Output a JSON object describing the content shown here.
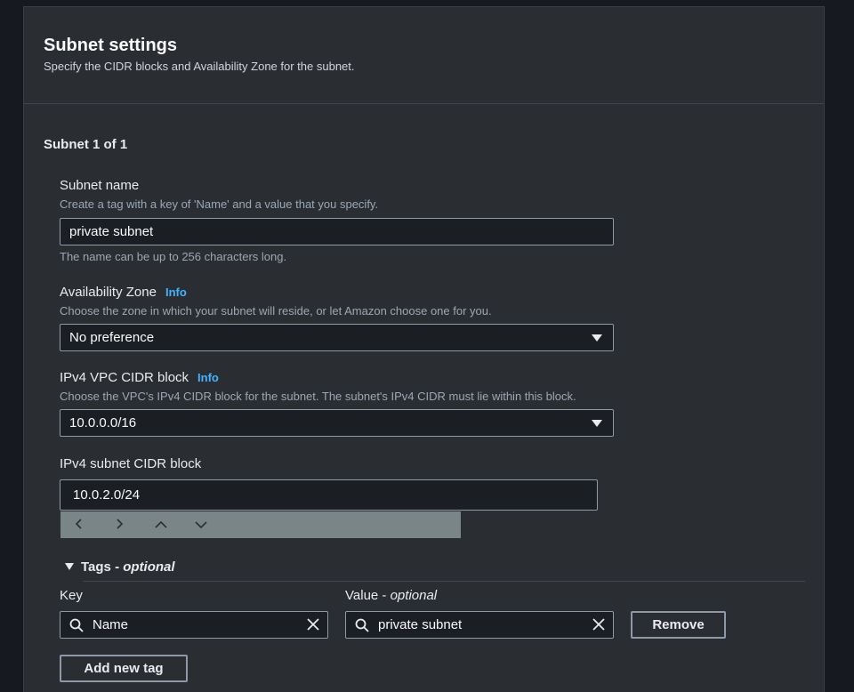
{
  "section": {
    "title": "Subnet settings",
    "subtitle": "Specify the CIDR blocks and Availability Zone for the subnet."
  },
  "subnet": {
    "counter": "Subnet 1 of 1",
    "name": {
      "label": "Subnet name",
      "description": "Create a tag with a key of 'Name' and a value that you specify.",
      "value": "private subnet",
      "hint": "The name can be up to 256 characters long."
    },
    "az": {
      "label": "Availability Zone",
      "info": "Info",
      "description": "Choose the zone in which your subnet will reside, or let Amazon choose one for you.",
      "value": "No preference"
    },
    "vpc_cidr": {
      "label": "IPv4 VPC CIDR block",
      "info": "Info",
      "description": "Choose the VPC's IPv4 CIDR block for the subnet. The subnet's IPv4 CIDR must lie within this block.",
      "value": "10.0.0.0/16"
    },
    "subnet_cidr": {
      "label": "IPv4 subnet CIDR block",
      "value": "10.0.2.0/24"
    },
    "stepper": {
      "left": "‹",
      "right": "›",
      "up": "⌃",
      "down": "⌄"
    }
  },
  "tags": {
    "toggle_label": "Tags - ",
    "toggle_optional": "optional",
    "key_header": "Key",
    "value_header": "Value - ",
    "value_optional": "optional",
    "rows": [
      {
        "key": "Name",
        "value": "private subnet"
      }
    ],
    "remove_label": "Remove",
    "add_label": "Add new tag"
  },
  "colors": {
    "panel_bg": "#2a2e33",
    "link": "#42b4ff",
    "stepper_bg": "#7a8587"
  }
}
